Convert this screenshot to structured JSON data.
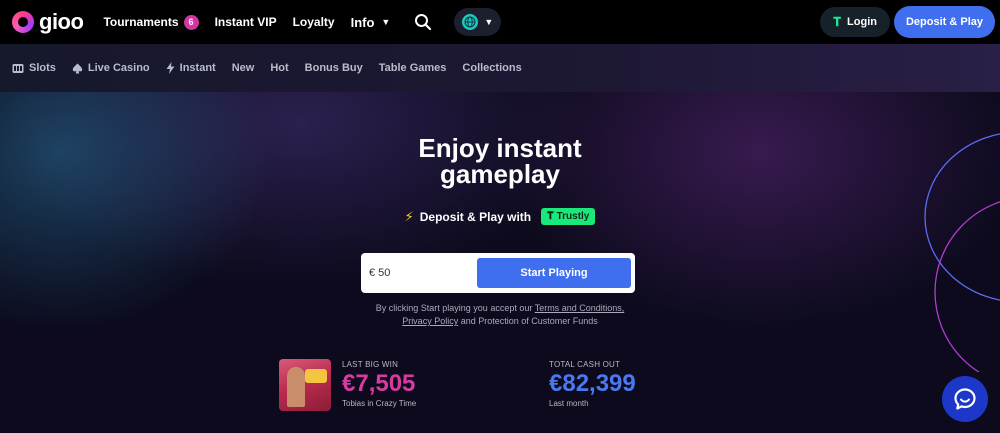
{
  "header": {
    "logo_text": "gioo",
    "nav": {
      "tournaments": "Tournaments",
      "tournaments_badge": "6",
      "instant_vip": "Instant VIP",
      "loyalty": "Loyalty",
      "info": "Info"
    },
    "login_label": "Login",
    "deposit_label": "Deposit & Play"
  },
  "categories": {
    "slots": "Slots",
    "live_casino": "Live Casino",
    "instant": "Instant",
    "new": "New",
    "hot": "Hot",
    "bonus_buy": "Bonus Buy",
    "table_games": "Table Games",
    "collections": "Collections"
  },
  "hero": {
    "title_line1": "Enjoy instant",
    "title_line2": "gameplay",
    "deposit_text": "Deposit & Play with",
    "trustly_label": "Trustly",
    "amount_value": "€ 50",
    "start_label": "Start Playing",
    "terms_prefix": "By clicking Start playing you accept our",
    "terms_link": "Terms and Conditions,",
    "privacy_link": "Privacy Policy",
    "terms_suffix": "and Protection of Customer Funds"
  },
  "stats": {
    "last_win_label": "LAST BIG WIN",
    "last_win_value": "€7,505",
    "last_win_sub": "Tobias in Crazy Time",
    "total_label": "TOTAL CASH OUT",
    "total_value": "€82,399",
    "total_sub": "Last month"
  },
  "colors": {
    "accent_blue": "#3f6fee",
    "accent_pink": "#d83aa2",
    "trustly_green": "#1be87a"
  }
}
